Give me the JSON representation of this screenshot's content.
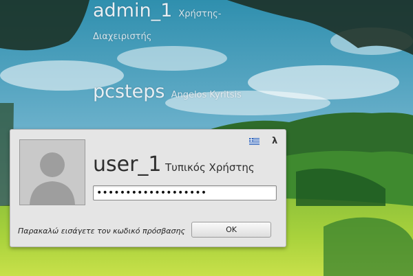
{
  "users": [
    {
      "username": "admin_1",
      "realname_line1": "Χρήστης-",
      "realname_line2": "Διαχειριστής"
    },
    {
      "username": "pcsteps",
      "realname": "Angelos Kyritsis"
    }
  ],
  "dialog": {
    "username": "user_1",
    "realname": "Τυπικός Χρήστης",
    "password_value": "•••••••••••••••••••",
    "prompt": "Παρακαλώ εισάγετε τον κωδικό πρόσβασης",
    "ok_label": "OK",
    "language_label": "λ",
    "flag_icon": "greek-flag-icon"
  }
}
